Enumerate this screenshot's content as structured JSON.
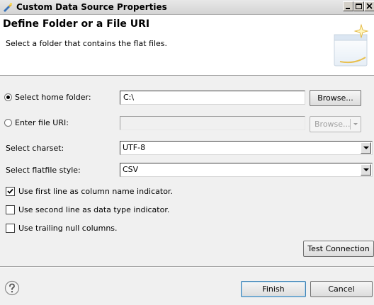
{
  "window": {
    "title": "Custom Data Source Properties"
  },
  "header": {
    "title": "Define Folder or a File URI",
    "description": "Select a folder that contains the flat files."
  },
  "form": {
    "home_folder_label": "Select home folder:",
    "home_folder_value": "C:\\",
    "home_folder_selected": true,
    "file_uri_label": "Enter file URI:",
    "file_uri_value": "",
    "browse_label": "Browse...",
    "browse_uri_label": "Browse...",
    "charset_label": "Select charset:",
    "charset_value": "UTF-8",
    "style_label": "Select flatfile style:",
    "style_value": "CSV",
    "first_line_label": "Use first line as column name indicator.",
    "first_line_checked": true,
    "second_line_label": "Use second line as data type indicator.",
    "second_line_checked": false,
    "trailing_null_label": "Use trailing null columns.",
    "trailing_null_checked": false,
    "test_connection_label": "Test Connection"
  },
  "footer": {
    "finish_label": "Finish",
    "cancel_label": "Cancel"
  },
  "icons": {
    "app": "eclipse-wizard-icon",
    "help": "help-icon",
    "wizard_banner": "folder-banner-icon"
  }
}
